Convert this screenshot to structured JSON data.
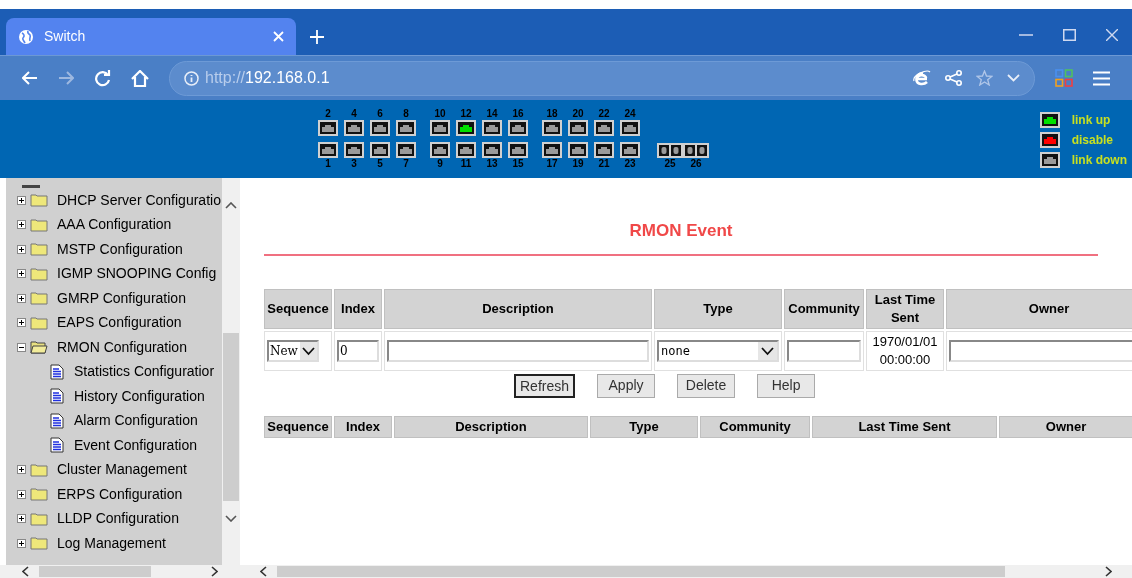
{
  "browser": {
    "tab_title": "Switch",
    "url_scheme": "http://",
    "url_host": "192.168.0.1"
  },
  "ports": {
    "groups": [
      {
        "kind": "rj45",
        "columns": [
          {
            "top": {
              "label": "2",
              "link_up": false,
              "disabled": false
            },
            "bottom": {
              "label": "1",
              "link_up": false,
              "disabled": false
            }
          },
          {
            "top": {
              "label": "4",
              "link_up": false,
              "disabled": false
            },
            "bottom": {
              "label": "3",
              "link_up": false,
              "disabled": false
            }
          },
          {
            "top": {
              "label": "6",
              "link_up": false,
              "disabled": false
            },
            "bottom": {
              "label": "5",
              "link_up": false,
              "disabled": false
            }
          },
          {
            "top": {
              "label": "8",
              "link_up": false,
              "disabled": false
            },
            "bottom": {
              "label": "7",
              "link_up": false,
              "disabled": false
            }
          }
        ]
      },
      {
        "kind": "rj45",
        "columns": [
          {
            "top": {
              "label": "10",
              "link_up": false,
              "disabled": false
            },
            "bottom": {
              "label": "9",
              "link_up": false,
              "disabled": false
            }
          },
          {
            "top": {
              "label": "12",
              "link_up": true,
              "disabled": false
            },
            "bottom": {
              "label": "11",
              "link_up": false,
              "disabled": false
            }
          },
          {
            "top": {
              "label": "14",
              "link_up": false,
              "disabled": false
            },
            "bottom": {
              "label": "13",
              "link_up": false,
              "disabled": false
            }
          },
          {
            "top": {
              "label": "16",
              "link_up": false,
              "disabled": false
            },
            "bottom": {
              "label": "15",
              "link_up": false,
              "disabled": false
            }
          }
        ]
      },
      {
        "kind": "rj45",
        "columns": [
          {
            "top": {
              "label": "18",
              "link_up": false,
              "disabled": false
            },
            "bottom": {
              "label": "17",
              "link_up": false,
              "disabled": false
            }
          },
          {
            "top": {
              "label": "20",
              "link_up": false,
              "disabled": false
            },
            "bottom": {
              "label": "19",
              "link_up": false,
              "disabled": false
            }
          },
          {
            "top": {
              "label": "22",
              "link_up": false,
              "disabled": false
            },
            "bottom": {
              "label": "21",
              "link_up": false,
              "disabled": false
            }
          },
          {
            "top": {
              "label": "24",
              "link_up": false,
              "disabled": false
            },
            "bottom": {
              "label": "23",
              "link_up": false,
              "disabled": false
            }
          }
        ]
      },
      {
        "kind": "sfp",
        "columns": [
          {
            "bottom": {
              "label": "25",
              "link_up": false,
              "disabled": false
            }
          },
          {
            "bottom": {
              "label": "26",
              "link_up": false,
              "disabled": false
            }
          }
        ]
      }
    ]
  },
  "legend": [
    {
      "kind": "up",
      "label": "link up"
    },
    {
      "kind": "disable",
      "label": "disable"
    },
    {
      "kind": "down",
      "label": "link down"
    }
  ],
  "sidebar": {
    "items": [
      {
        "label": "DHCP Server Configuratio",
        "expanded": false
      },
      {
        "label": "AAA Configuration",
        "expanded": false
      },
      {
        "label": "MSTP Configuration",
        "expanded": false
      },
      {
        "label": "IGMP SNOOPING Config",
        "expanded": false
      },
      {
        "label": "GMRP Configuration",
        "expanded": false
      },
      {
        "label": "EAPS Configuration",
        "expanded": false
      },
      {
        "label": "RMON Configuration",
        "expanded": true,
        "children": [
          {
            "label": "Statistics Configuratior"
          },
          {
            "label": "History Configuration"
          },
          {
            "label": "Alarm Configuration"
          },
          {
            "label": "Event Configuration"
          }
        ]
      },
      {
        "label": "Cluster Management",
        "expanded": false
      },
      {
        "label": "ERPS Configuration",
        "expanded": false
      },
      {
        "label": "LLDP Configuration",
        "expanded": false
      },
      {
        "label": "Log Management",
        "expanded": false
      }
    ]
  },
  "page_title": "RMON Event",
  "form": {
    "columns": [
      "Sequence",
      "Index",
      "Description",
      "Type",
      "Community",
      "Last Time Sent",
      "Owner"
    ],
    "sequence": "New",
    "index": "0",
    "type": "none",
    "last_time_sent": "1970/01/01 00:00:00"
  },
  "buttons": [
    {
      "label": "Refresh",
      "focused": true
    },
    {
      "label": "Apply",
      "focused": false
    },
    {
      "label": "Delete",
      "focused": false
    },
    {
      "label": "Help",
      "focused": false
    }
  ],
  "list": {
    "columns": [
      "Sequence",
      "Index",
      "Description",
      "Type",
      "Community",
      "Last Time Sent",
      "Owner"
    ]
  }
}
